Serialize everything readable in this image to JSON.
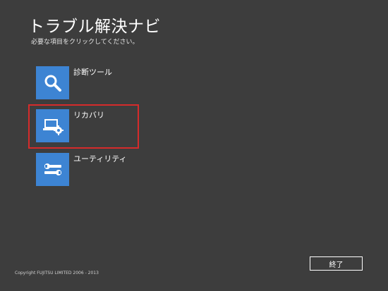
{
  "app": {
    "title": "トラブル解決ナビ",
    "subtitle": "必要な項目をクリックしてください。"
  },
  "menu": {
    "items": [
      {
        "label": "診断ツール",
        "icon": "magnifier-icon"
      },
      {
        "label": "リカバリ",
        "icon": "laptop-gear-icon"
      },
      {
        "label": "ユーティリティ",
        "icon": "wrench-icon"
      }
    ]
  },
  "footer": {
    "copyright": "Copyright FUJITSU LIMITED 2006 - 2013",
    "end_button": "終了"
  },
  "colors": {
    "background": "#3d3d3d",
    "tile": "#3d84d3",
    "highlight": "#d62b2b"
  }
}
